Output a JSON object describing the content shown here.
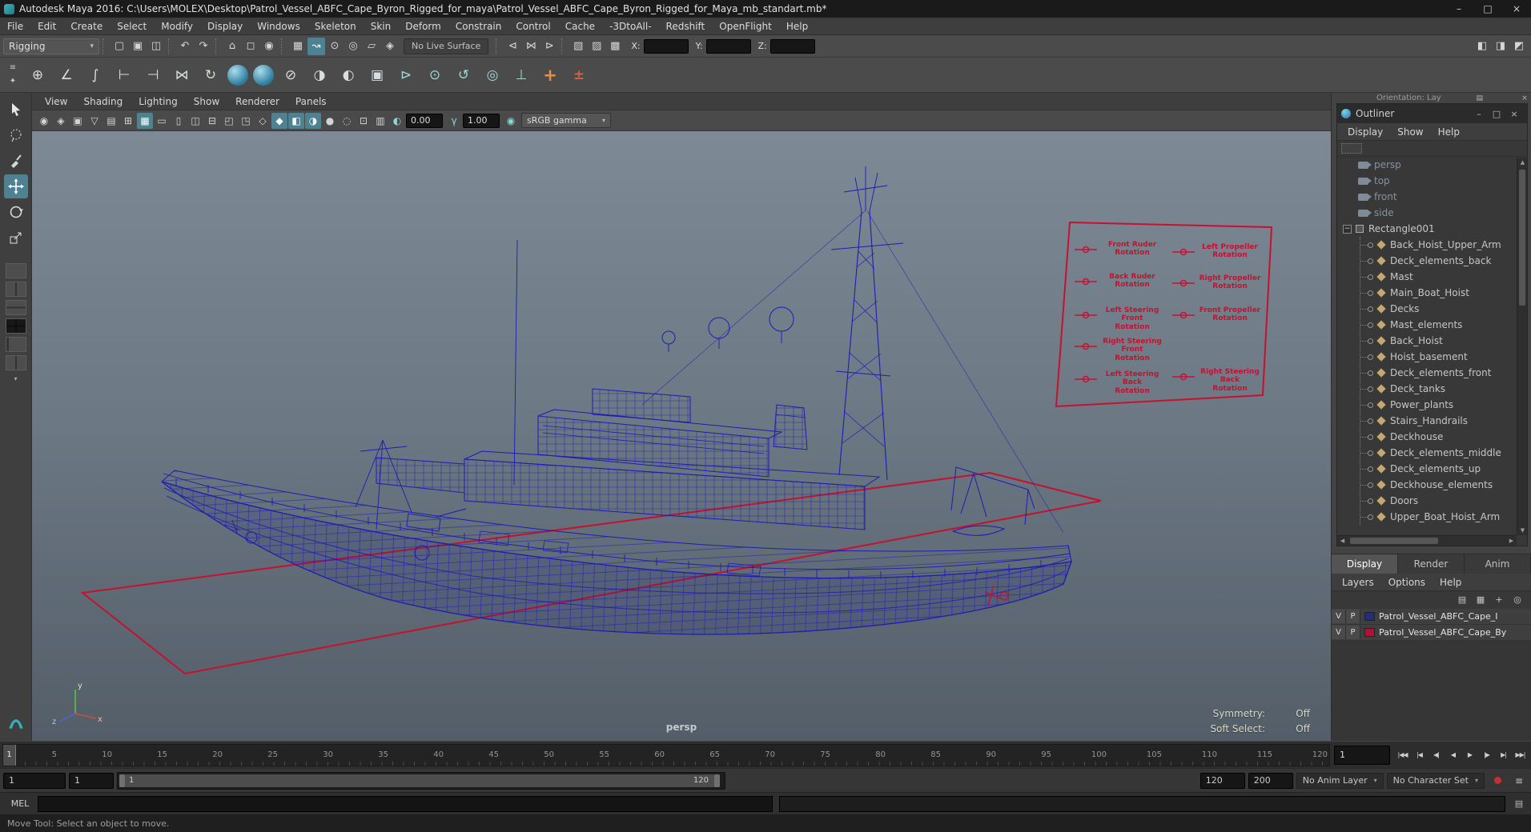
{
  "title_bar": {
    "title": "Autodesk Maya 2016: C:\\Users\\MOLEX\\Desktop\\Patrol_Vessel_ABFC_Cape_Byron_Rigged_for_maya\\Patrol_Vessel_ABFC_Cape_Byron_Rigged_for_Maya_mb_standart.mb*"
  },
  "menu_bar": [
    "File",
    "Edit",
    "Create",
    "Select",
    "Modify",
    "Display",
    "Windows",
    "Skeleton",
    "Skin",
    "Deform",
    "Constrain",
    "Control",
    "Cache",
    "-3DtoAll-",
    "Redshift",
    "OpenFlight",
    "Help"
  ],
  "status_line": {
    "menu_set": "Rigging",
    "live_surface": "No Live Surface",
    "x_label": "X:",
    "y_label": "Y:",
    "z_label": "Z:"
  },
  "shelf_items": [
    {
      "name": "joint-tool-icon",
      "glyph": "⊕"
    },
    {
      "name": "ik-handle-icon",
      "glyph": "∠"
    },
    {
      "name": "ik-spline-handle-icon",
      "glyph": "∫"
    },
    {
      "name": "insert-joint-icon",
      "glyph": "⊢"
    },
    {
      "name": "reroot-joint-icon",
      "glyph": "⊣"
    },
    {
      "name": "mirror-joint-icon",
      "glyph": "⋈"
    },
    {
      "name": "orient-joint-icon",
      "glyph": "↻"
    },
    {
      "name": "smooth-bind-icon",
      "glyph": "",
      "cls": "sphere"
    },
    {
      "name": "interactive-bind-icon",
      "glyph": "",
      "cls": "sphere"
    },
    {
      "name": "detach-skin-icon",
      "glyph": "⊘"
    },
    {
      "name": "paint-skin-weights-icon",
      "glyph": "◑"
    },
    {
      "name": "mirror-skin-weights-icon",
      "glyph": "◐"
    },
    {
      "name": "copy-skin-weights-icon",
      "glyph": "▣"
    },
    {
      "name": "parent-constraint-icon",
      "glyph": "⊳",
      "cls": "teal"
    },
    {
      "name": "point-constraint-icon",
      "glyph": "⊙",
      "cls": "teal"
    },
    {
      "name": "orient-constraint-icon",
      "glyph": "↺",
      "cls": "teal"
    },
    {
      "name": "aim-constraint-icon",
      "glyph": "◎",
      "cls": "teal"
    },
    {
      "name": "pole-vector-constraint-icon",
      "glyph": "⊥",
      "cls": "teal"
    },
    {
      "name": "add-attribute-icon",
      "glyph": "+",
      "cls": "orange"
    },
    {
      "name": "set-driven-key-icon",
      "glyph": "±",
      "cls": "red"
    }
  ],
  "panel_menus": [
    "View",
    "Shading",
    "Lighting",
    "Show",
    "Renderer",
    "Panels"
  ],
  "viewport_bar": {
    "icons": [
      {
        "name": "select-camera-icon",
        "glyph": "◉"
      },
      {
        "name": "lock-camera-icon",
        "glyph": "◈"
      },
      {
        "name": "camera-attributes-icon",
        "glyph": "▣"
      },
      {
        "name": "bookmarks-icon",
        "glyph": "▽"
      },
      {
        "name": "image-plane-icon",
        "glyph": "▤"
      },
      {
        "name": "pan-zoom-icon",
        "glyph": "⊞"
      },
      {
        "name": "grid-icon",
        "glyph": "▦",
        "cls": "active"
      },
      {
        "name": "film-gate-icon",
        "glyph": "▭"
      },
      {
        "name": "resolution-gate-icon",
        "glyph": "▯"
      },
      {
        "name": "gate-mask-icon",
        "glyph": "◫"
      },
      {
        "name": "field-chart-icon",
        "glyph": "⊟"
      },
      {
        "name": "safe-action-icon",
        "glyph": "◰"
      },
      {
        "name": "safe-title-icon",
        "glyph": "◳"
      },
      {
        "name": "wireframe-mode-icon",
        "glyph": "◇"
      },
      {
        "name": "shaded-mode-icon",
        "glyph": "◆",
        "cls": "active"
      },
      {
        "name": "textured-mode-icon",
        "glyph": "◧",
        "cls": "active"
      },
      {
        "name": "lighting-icon",
        "glyph": "◑",
        "cls": "active"
      },
      {
        "name": "shadows-icon",
        "glyph": "●"
      },
      {
        "name": "screen-space-ao-icon",
        "glyph": "◌"
      },
      {
        "name": "isolate-select-icon",
        "glyph": "⊡"
      },
      {
        "name": "xray-icon",
        "glyph": "▥"
      }
    ],
    "exposure": "0.00",
    "gamma": "1.00",
    "colorspace": "sRGB gamma"
  },
  "viewport": {
    "camera": "persp",
    "wireframe_color": "#1d1db2",
    "control_color": "#c41230",
    "hud": [
      {
        "label": "Symmetry:",
        "value": "Off"
      },
      {
        "label": "Soft Select:",
        "value": "Off"
      }
    ],
    "axis_x": "x",
    "axis_y": "y",
    "axis_z": "z"
  },
  "picker": {
    "color": "#c41230",
    "labels": [
      "Front Ruder\nRotation",
      "Back Ruder\nRotation",
      "Left Steering Front\nRotation",
      "Right Steering Front\nRotation",
      "Left Steering Back\nRotation",
      "Left Propeller\nRotation",
      "Right Propeller\nRotation",
      "Front Propeller\nRotation",
      "Right Steering Back\nRotation"
    ]
  },
  "right_panel": {
    "clipped_title": "Orientation: Lay"
  },
  "outliner": {
    "title": "Outliner",
    "menus": [
      "Display",
      "Show",
      "Help"
    ],
    "cameras": [
      "persp",
      "top",
      "front",
      "side"
    ],
    "root": "Rectangle001",
    "children": [
      "Back_Hoist_Upper_Arm",
      "Deck_elements_back",
      "Mast",
      "Main_Boat_Hoist",
      "Decks",
      "Mast_elements",
      "Back_Hoist",
      "Hoist_basement",
      "Deck_elements_front",
      "Deck_tanks",
      "Power_plants",
      "Stairs_Handrails",
      "Deckhouse",
      "Deck_elements_middle",
      "Deck_elements_up",
      "Deckhouse_elements",
      "Doors",
      "Upper_Boat_Hoist_Arm"
    ]
  },
  "layer_editor": {
    "tabs": [
      "Display",
      "Render",
      "Anim"
    ],
    "menus": [
      "Layers",
      "Options",
      "Help"
    ],
    "layers": [
      {
        "v": "V",
        "p": "P",
        "color": "#232d7a",
        "name": "Patrol_Vessel_ABFC_Cape_I"
      },
      {
        "v": "V",
        "p": "P",
        "color": "#b01236",
        "name": "Patrol_Vessel_ABFC_Cape_By"
      }
    ]
  },
  "time_slider": {
    "ticks": [
      "5",
      "10",
      "15",
      "20",
      "25",
      "30",
      "35",
      "40",
      "45",
      "50",
      "55",
      "60",
      "65",
      "70",
      "75",
      "80",
      "85",
      "90",
      "95",
      "100",
      "105",
      "110",
      "115",
      "120"
    ],
    "current_frame": "1",
    "frame_field": "1",
    "playback": {
      "go_start": "|◀◀",
      "back_key": "|◀",
      "back_frame": "◀|",
      "play_back": "◀",
      "play_fwd": "▶",
      "fwd_frame": "|▶",
      "fwd_key": "▶|",
      "go_end": "▶▶|"
    }
  },
  "range_slider": {
    "playback_start": "1",
    "anim_start": "1",
    "bar_start": "1",
    "bar_end": "120",
    "anim_end": "120",
    "playback_end": "200",
    "anim_layer": "No Anim Layer",
    "character_set": "No Character Set"
  },
  "command_line": {
    "label": "MEL"
  },
  "help_line": {
    "text": "Move Tool: Select an object to move."
  },
  "icons": {
    "win_min": "–",
    "win_max": "□",
    "win_close": "×",
    "dropdown": "▾",
    "new_scene": "▢",
    "open_scene": "▣",
    "save_scene": "◫",
    "undo": "↶",
    "redo": "↷",
    "select_hierarchy": "⌂",
    "select_object": "◻",
    "select_component": "◉",
    "snap_grid": "▦",
    "snap_curve": "↝",
    "snap_point": "⊙",
    "snap_center": "◎",
    "snap_plane": "▱",
    "make_live": "◈",
    "history_input": "⊲",
    "history_construction": "⋈",
    "history_output": "⊳",
    "render_view": "▧",
    "ipr_render": "▨",
    "render_settings": "▩",
    "toggle_attr_editor": "◧",
    "toggle_tool_settings": "◨",
    "toggle_channel_box": "◩",
    "shelf_menu": "≡",
    "shelf_gear": "✦",
    "exposure": "◐",
    "gamma": "γ",
    "colorspace_dot": "◉",
    "scroll_up": "▲",
    "scroll_down": "▼",
    "scroll_left": "◀",
    "scroll_right": "▶",
    "expander_collapse": "−",
    "layer_icons": [
      "▤",
      "▦",
      "+",
      "◎"
    ],
    "script_editor": "▤",
    "anim_prefs": "≡",
    "rp_list": "▤",
    "rp_close": "×"
  }
}
